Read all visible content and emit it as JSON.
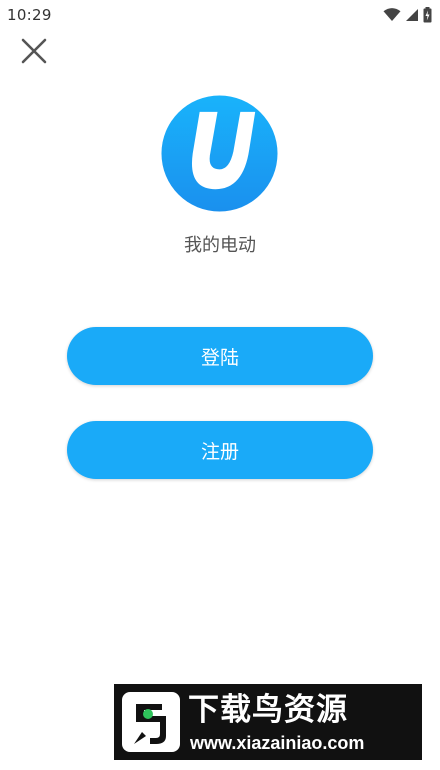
{
  "status_bar": {
    "time": "10:29",
    "icons": [
      "wifi-icon",
      "cellular-signal-icon",
      "battery-icon"
    ]
  },
  "header": {
    "close_icon": "close-icon"
  },
  "app": {
    "logo_icon": "app-logo-u-icon",
    "name": "我的电动",
    "brand_color": "#1aaaf8"
  },
  "actions": {
    "login_label": "登陆",
    "register_label": "注册"
  },
  "watermark": {
    "title": "下载鸟资源",
    "url": "www.xiazainiao.com"
  }
}
